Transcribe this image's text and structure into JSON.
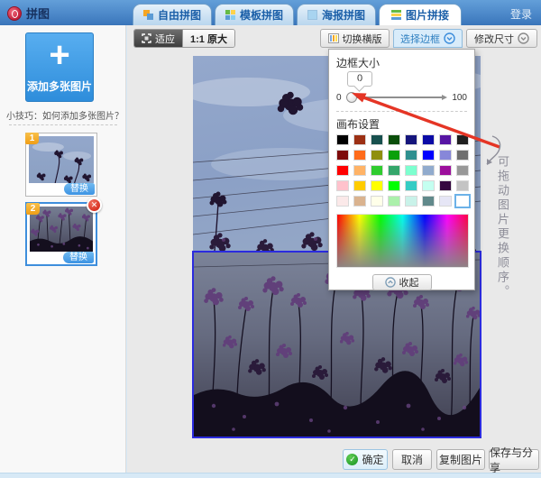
{
  "header": {
    "app_title": "拼图",
    "login_label": "登录",
    "tabs": [
      {
        "label": "自由拼图"
      },
      {
        "label": "模板拼图"
      },
      {
        "label": "海报拼图"
      },
      {
        "label": "图片拼接"
      }
    ]
  },
  "sidebar": {
    "add_button_plus": "+",
    "add_button_label": "添加多张图片",
    "tip_text": "小技巧：如何添加多张图片？",
    "thumbnails": [
      {
        "index": "1",
        "replace_label": "替换"
      },
      {
        "index": "2",
        "replace_label": "替换"
      }
    ],
    "delete_glyph": "✕"
  },
  "toolbar": {
    "fit_label": "适应",
    "original_label": "1:1 原大",
    "switch_layout_label": "切换横版",
    "select_border_label": "选择边框",
    "resize_label": "修改尺寸"
  },
  "border_panel": {
    "size_label": "边框大小",
    "size_value": "0",
    "slider_min": "0",
    "slider_max": "100",
    "canvas_label": "画布设置",
    "collapse_label": "收起",
    "palette": [
      "#000000",
      "#9C3014",
      "#17504E",
      "#0B4E0B",
      "#15157C",
      "#0B0BA6",
      "#5715A3",
      "#1F1F1F",
      "#7E0B0B",
      "#FF6B1A",
      "#8F8F0E",
      "#0AA00A",
      "#2F8F8F",
      "#0000FF",
      "#8787D9",
      "#6F6F6F",
      "#FF0000",
      "#FFB366",
      "#2FCC2F",
      "#35A66B",
      "#7DFFCF",
      "#91ABCD",
      "#9C0F9C",
      "#989898",
      "#FFC2CC",
      "#FFCC00",
      "#FFFF00",
      "#00FF00",
      "#35CCC4",
      "#C4FFF0",
      "#350840",
      "#C4C4C4",
      "#FBE9E9",
      "#DAB38F",
      "#FFFFE9",
      "#ABF0AB",
      "#C9F2E9",
      "#61898B",
      "#E6E6F6",
      "#FFFFFF"
    ],
    "selected_color": "#FFFFFF"
  },
  "canvas": {
    "note_text": "可拖动图片更换顺序。"
  },
  "footer": {
    "confirm_glyph": "✓",
    "confirm_label": "确定",
    "cancel_label": "取消",
    "copy_label": "复制图片",
    "save_share_label": "保存与分享"
  },
  "colors": {
    "accent_blue": "#3D8EDC",
    "selection_border_blue": "#2B2BDE",
    "annotation_red": "#E53525"
  }
}
